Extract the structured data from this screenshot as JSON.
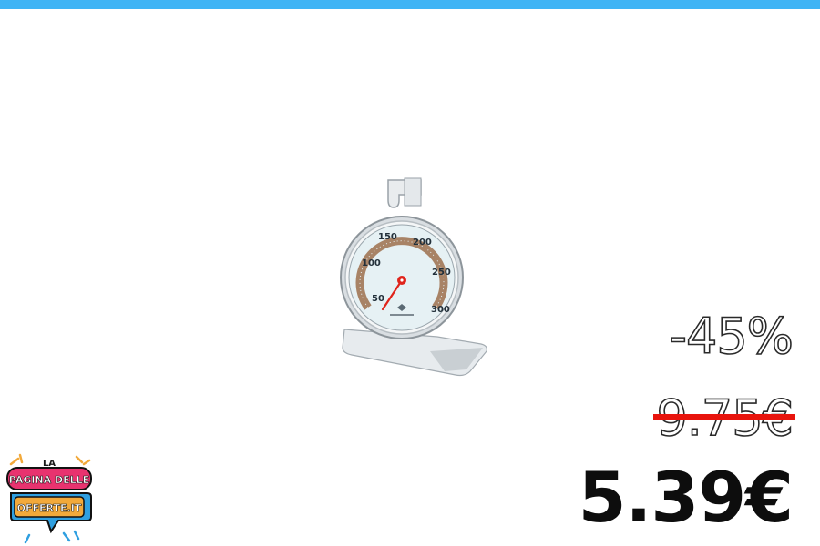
{
  "product_image": {
    "icon": "oven-thermometer-icon"
  },
  "dial": {
    "scale": [
      "50",
      "100",
      "150",
      "200",
      "250",
      "300"
    ]
  },
  "pricing": {
    "discount": "-45%",
    "old_price": "9.75€",
    "new_price": "5.39€"
  },
  "logo": {
    "line1": "LA",
    "line2": "PAGINA DELLE",
    "line3": "OFFERTE.IT"
  },
  "colors": {
    "top_bar": "#3fb4f5",
    "strike": "#e8140d",
    "logo_blue": "#2f9fe0",
    "logo_pink": "#e8336f",
    "logo_orange": "#f2a93b"
  }
}
